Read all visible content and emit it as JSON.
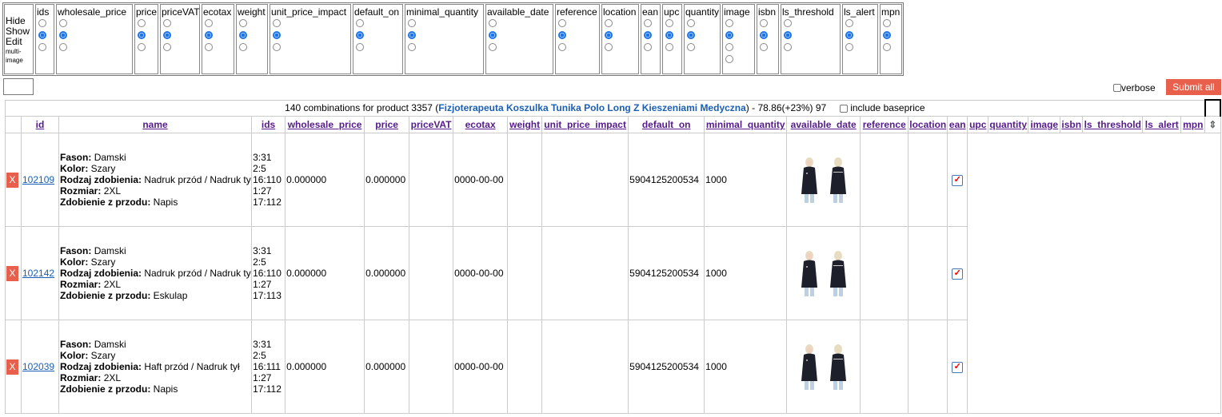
{
  "field_selector": {
    "modes": [
      "Hide",
      "Show",
      "Edit"
    ],
    "multi_image_label": "multi-image",
    "fields": [
      {
        "name": "ids",
        "options": 3,
        "selected": 1
      },
      {
        "name": "wholesale_price",
        "options": 3,
        "selected": 1
      },
      {
        "name": "price",
        "options": 3,
        "selected": 1
      },
      {
        "name": "priceVAT",
        "options": 3,
        "selected": 1
      },
      {
        "name": "ecotax",
        "options": 3,
        "selected": 1
      },
      {
        "name": "weight",
        "options": 3,
        "selected": 1
      },
      {
        "name": "unit_price_impact",
        "options": 3,
        "selected": 1
      },
      {
        "name": "default_on",
        "options": 3,
        "selected": 1
      },
      {
        "name": "minimal_quantity",
        "options": 3,
        "selected": 1
      },
      {
        "name": "available_date",
        "options": 3,
        "selected": 1
      },
      {
        "name": "reference",
        "options": 3,
        "selected": 1
      },
      {
        "name": "location",
        "options": 3,
        "selected": 1
      },
      {
        "name": "ean",
        "options": 3,
        "selected": 1
      },
      {
        "name": "upc",
        "options": 3,
        "selected": 1
      },
      {
        "name": "quantity",
        "options": 3,
        "selected": 1
      },
      {
        "name": "image",
        "options": 4,
        "selected": 1
      },
      {
        "name": "isbn",
        "options": 3,
        "selected": 1
      },
      {
        "name": "ls_threshold",
        "options": 3,
        "selected": 1
      },
      {
        "name": "ls_alert",
        "options": 3,
        "selected": 1
      },
      {
        "name": "mpn",
        "options": 3,
        "selected": 1
      }
    ]
  },
  "toolbar": {
    "verbose_label": "verbose",
    "submit_label": "Submit all"
  },
  "summary": {
    "prefix": "140 combinations for product 3357 (",
    "product_name": "Fizjoterapeuta Koszulka Tunika Polo Long Z Kieszeniami Medyczna",
    "suffix": ") - 78.86(+23%) 97",
    "include_baseprice_label": "include baseprice"
  },
  "columns": [
    "id",
    "name",
    "ids",
    "wholesale_price",
    "price",
    "priceVAT",
    "ecotax",
    "weight",
    "unit_price_impact",
    "default_on",
    "minimal_quantity",
    "available_date",
    "reference",
    "location",
    "ean",
    "upc",
    "quantity",
    "image",
    "isbn",
    "ls_threshold",
    "ls_alert",
    "mpn"
  ],
  "rows": [
    {
      "delete": "X",
      "id": "102109",
      "attrs": [
        [
          "Fason:",
          "Damski"
        ],
        [
          "Kolor:",
          "Szary"
        ],
        [
          "Rodzaj zdobienia:",
          "Nadruk przód / Nadruk tył"
        ],
        [
          "Rozmiar:",
          "2XL"
        ],
        [
          "Zdobienie z przodu:",
          "Napis"
        ]
      ],
      "ids": [
        "3:31",
        "2:5",
        "16:110",
        "1:27",
        "17:112"
      ],
      "wholesale_price": "0.000000",
      "price": "0.000000",
      "date": "0000-00-00",
      "ean": "5904125200534",
      "minimal_quantity": "1000"
    },
    {
      "delete": "X",
      "id": "102142",
      "attrs": [
        [
          "Fason:",
          "Damski"
        ],
        [
          "Kolor:",
          "Szary"
        ],
        [
          "Rodzaj zdobienia:",
          "Nadruk przód / Nadruk tył"
        ],
        [
          "Rozmiar:",
          "2XL"
        ],
        [
          "Zdobienie z przodu:",
          "Eskulap"
        ]
      ],
      "ids": [
        "3:31",
        "2:5",
        "16:110",
        "1:27",
        "17:113"
      ],
      "wholesale_price": "0.000000",
      "price": "0.000000",
      "date": "0000-00-00",
      "ean": "5904125200534",
      "minimal_quantity": "1000"
    },
    {
      "delete": "X",
      "id": "102039",
      "attrs": [
        [
          "Fason:",
          "Damski"
        ],
        [
          "Kolor:",
          "Szary"
        ],
        [
          "Rodzaj zdobienia:",
          "Haft przód / Nadruk tył"
        ],
        [
          "Rozmiar:",
          "2XL"
        ],
        [
          "Zdobienie z przodu:",
          "Napis"
        ]
      ],
      "ids": [
        "3:31",
        "2:5",
        "16:111",
        "1:27",
        "17:112"
      ],
      "wholesale_price": "0.000000",
      "price": "0.000000",
      "date": "0000-00-00",
      "ean": "5904125200534",
      "minimal_quantity": "1000"
    }
  ]
}
